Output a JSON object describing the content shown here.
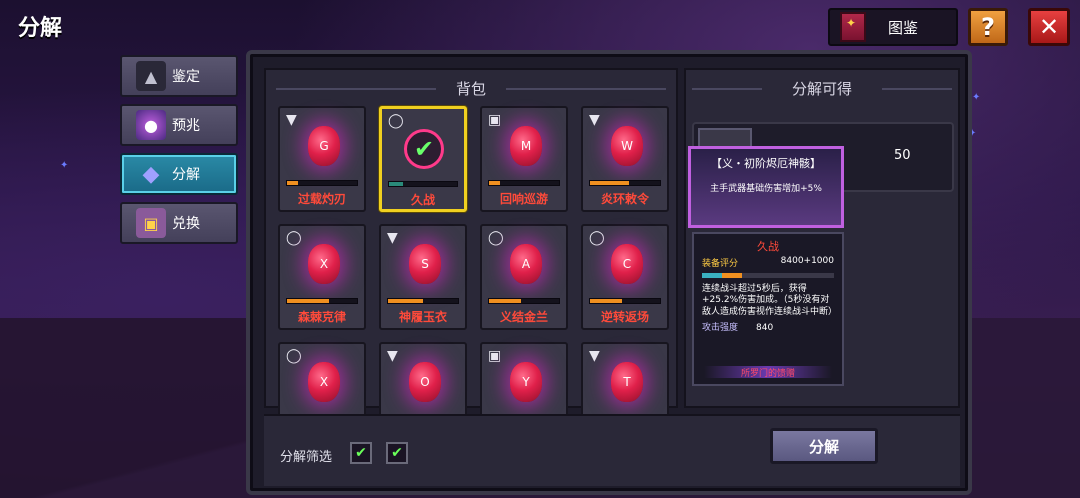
{
  "header": {
    "title": "分解",
    "codex_label": "图鉴",
    "help_label": "?",
    "close_label": "✕"
  },
  "sidebar": {
    "items": [
      {
        "label": "鉴定",
        "icon": "anvil-icon",
        "active": false
      },
      {
        "label": "预兆",
        "icon": "crystal-ball-icon",
        "active": false
      },
      {
        "label": "分解",
        "icon": "diamond-icon",
        "active": true
      },
      {
        "label": "兑换",
        "icon": "chest-icon",
        "active": false
      }
    ]
  },
  "bag": {
    "title": "背包",
    "items": [
      {
        "name": "过载灼刃",
        "slot": "helmet-icon",
        "glyph": "G",
        "progress": 0.15,
        "selected": false
      },
      {
        "name": "久战",
        "slot": "ring-icon",
        "glyph": "",
        "progress": 0.2,
        "selected": true
      },
      {
        "name": "回响巡游",
        "slot": "armor-icon",
        "glyph": "M",
        "progress": 0.15,
        "selected": false
      },
      {
        "name": "炎环敕令",
        "slot": "helmet-icon",
        "glyph": "W",
        "progress": 0.55,
        "selected": false
      },
      {
        "name": "森棘克律",
        "slot": "ring-icon",
        "glyph": "X",
        "progress": 0.6,
        "selected": false
      },
      {
        "name": "神履玉衣",
        "slot": "helmet-icon",
        "glyph": "S",
        "progress": 0.5,
        "selected": false
      },
      {
        "name": "义结金兰",
        "slot": "ring-icon",
        "glyph": "A",
        "progress": 0.45,
        "selected": false
      },
      {
        "name": "逆转返场",
        "slot": "ring-icon",
        "glyph": "C",
        "progress": 0.45,
        "selected": false
      },
      {
        "name": "",
        "slot": "ring-icon",
        "glyph": "X",
        "progress": 0,
        "selected": false
      },
      {
        "name": "",
        "slot": "helmet-icon",
        "glyph": "O",
        "progress": 0,
        "selected": false
      },
      {
        "name": "",
        "slot": "armor-icon",
        "glyph": "Y",
        "progress": 0,
        "selected": false
      },
      {
        "name": "",
        "slot": "helmet-icon",
        "glyph": "T",
        "progress": 0,
        "selected": false
      }
    ]
  },
  "yield": {
    "title": "分解可得",
    "count": "50",
    "tooltip_title": "【义・初阶烬厄神骸】",
    "tooltip_desc": "主手武器基础伤害增加+5%"
  },
  "detail": {
    "name": "久战",
    "score_label": "装备评分",
    "score_value": "8400+1000",
    "score_fill": 0.3,
    "description": "连续战斗超过5秒后，获得+25.2%伤害加成。（5秒没有对敌人造成伤害视作连续战斗中断）",
    "attack_label": "攻击强度",
    "attack_value": "840",
    "set_label": "所罗门的馈赠"
  },
  "footer": {
    "filter_label": "分解筛选",
    "decompose_label": "分解"
  },
  "colors": {
    "accent_selected": "#f0d020",
    "item_name": "#ff4a3a",
    "active_tab": "#2a8aa6"
  }
}
